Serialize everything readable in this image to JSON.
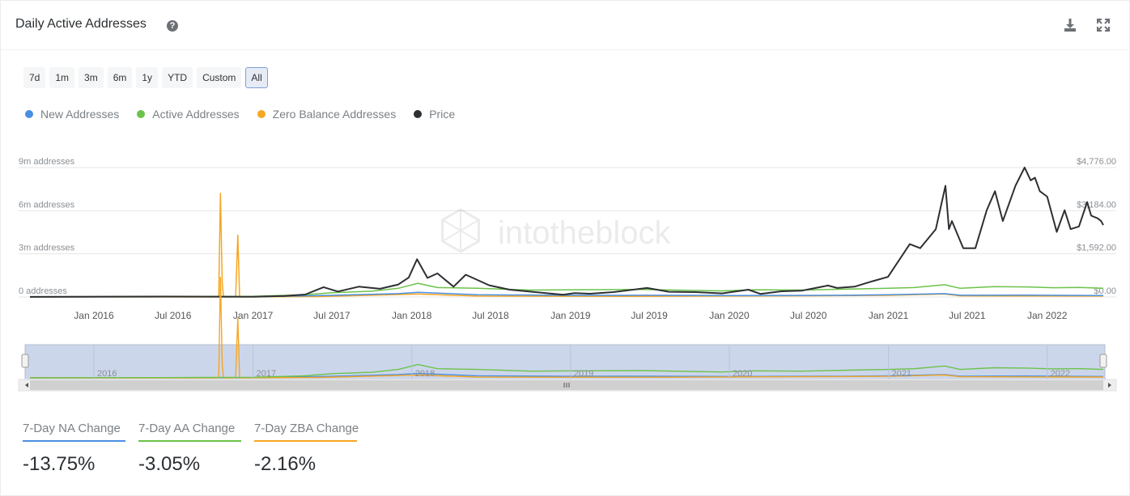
{
  "header": {
    "title": "Daily Active Addresses",
    "help_icon": "question-circle-icon",
    "download_icon": "download-icon",
    "expand_icon": "expand-icon"
  },
  "ranges": [
    "7d",
    "1m",
    "3m",
    "6m",
    "1y",
    "YTD",
    "Custom",
    "All"
  ],
  "active_range": "All",
  "legend": [
    {
      "name": "New Addresses",
      "color": "#4a90e2"
    },
    {
      "name": "Active Addresses",
      "color": "#6cc24a"
    },
    {
      "name": "Zero Balance Addresses",
      "color": "#f5a623"
    },
    {
      "name": "Price",
      "color": "#2d3033"
    }
  ],
  "watermark": "intotheblock",
  "chart_data": {
    "type": "line",
    "x_ticks": [
      "Jan 2016",
      "Jul 2016",
      "Jan 2017",
      "Jul 2017",
      "Jan 2018",
      "Jul 2018",
      "Jan 2019",
      "Jul 2019",
      "Jan 2020",
      "Jul 2020",
      "Jan 2021",
      "Jul 2021",
      "Jan 2022"
    ],
    "y_left_ticks": [
      "0 addresses",
      "3m addresses",
      "6m addresses",
      "9m addresses"
    ],
    "y_left_range": [
      0,
      9000000
    ],
    "y_right_ticks": [
      "$0.00",
      "$1,592.00",
      "$3,184.00",
      "$4,776.00"
    ],
    "y_right_range": [
      0,
      4776
    ],
    "x_range": [
      "2015-08-07",
      "2022-05-10"
    ],
    "navigator_labels": [
      "2016",
      "2017",
      "2018",
      "2019",
      "2020",
      "2021",
      "2022"
    ],
    "grid": true,
    "series": [
      {
        "name": "Price",
        "axis": "right",
        "color": "#2d3033",
        "points": [
          [
            "2015-08-07",
            2
          ],
          [
            "2016-06-15",
            14
          ],
          [
            "2017-01-01",
            8
          ],
          [
            "2017-03-15",
            40
          ],
          [
            "2017-05-01",
            90
          ],
          [
            "2017-06-12",
            360
          ],
          [
            "2017-07-15",
            200
          ],
          [
            "2017-09-01",
            380
          ],
          [
            "2017-10-20",
            300
          ],
          [
            "2017-12-01",
            460
          ],
          [
            "2017-12-25",
            720
          ],
          [
            "2018-01-13",
            1390
          ],
          [
            "2018-02-06",
            700
          ],
          [
            "2018-03-01",
            870
          ],
          [
            "2018-04-07",
            380
          ],
          [
            "2018-05-05",
            820
          ],
          [
            "2018-06-28",
            430
          ],
          [
            "2018-08-14",
            270
          ],
          [
            "2018-09-15",
            220
          ],
          [
            "2018-11-25",
            110
          ],
          [
            "2018-12-15",
            85
          ],
          [
            "2019-01-10",
            140
          ],
          [
            "2019-02-15",
            120
          ],
          [
            "2019-04-10",
            180
          ],
          [
            "2019-06-26",
            330
          ],
          [
            "2019-08-15",
            190
          ],
          [
            "2019-10-15",
            180
          ],
          [
            "2019-12-15",
            130
          ],
          [
            "2020-02-14",
            270
          ],
          [
            "2020-03-13",
            110
          ],
          [
            "2020-04-30",
            210
          ],
          [
            "2020-06-15",
            230
          ],
          [
            "2020-08-15",
            420
          ],
          [
            "2020-09-05",
            330
          ],
          [
            "2020-10-15",
            380
          ],
          [
            "2020-11-25",
            580
          ],
          [
            "2020-12-31",
            740
          ],
          [
            "2021-02-19",
            1950
          ],
          [
            "2021-03-15",
            1800
          ],
          [
            "2021-04-20",
            2500
          ],
          [
            "2021-05-12",
            4100
          ],
          [
            "2021-05-20",
            2500
          ],
          [
            "2021-05-27",
            2800
          ],
          [
            "2021-06-22",
            1800
          ],
          [
            "2021-07-20",
            1800
          ],
          [
            "2021-08-15",
            3200
          ],
          [
            "2021-09-03",
            3900
          ],
          [
            "2021-09-21",
            2800
          ],
          [
            "2021-10-20",
            4100
          ],
          [
            "2021-11-10",
            4776
          ],
          [
            "2021-11-24",
            4300
          ],
          [
            "2021-12-04",
            4400
          ],
          [
            "2021-12-15",
            3900
          ],
          [
            "2022-01-01",
            3700
          ],
          [
            "2022-01-23",
            2400
          ],
          [
            "2022-02-10",
            3200
          ],
          [
            "2022-02-24",
            2500
          ],
          [
            "2022-03-15",
            2600
          ],
          [
            "2022-04-03",
            3500
          ],
          [
            "2022-04-12",
            3000
          ],
          [
            "2022-04-27",
            2900
          ],
          [
            "2022-05-05",
            2800
          ],
          [
            "2022-05-10",
            2650
          ]
        ]
      },
      {
        "name": "Active Addresses",
        "axis": "left",
        "color": "#6cc24a",
        "points": [
          [
            "2015-08-07",
            8000
          ],
          [
            "2016-06-01",
            20000
          ],
          [
            "2017-01-01",
            40000
          ],
          [
            "2017-05-01",
            150000
          ],
          [
            "2017-07-01",
            300000
          ],
          [
            "2017-10-01",
            400000
          ],
          [
            "2017-12-01",
            600000
          ],
          [
            "2018-01-15",
            950000
          ],
          [
            "2018-03-01",
            650000
          ],
          [
            "2018-06-01",
            600000
          ],
          [
            "2018-10-01",
            480000
          ],
          [
            "2019-01-15",
            500000
          ],
          [
            "2019-06-15",
            520000
          ],
          [
            "2019-12-15",
            420000
          ],
          [
            "2020-03-01",
            500000
          ],
          [
            "2020-06-15",
            480000
          ],
          [
            "2020-10-01",
            550000
          ],
          [
            "2021-01-01",
            600000
          ],
          [
            "2021-03-01",
            650000
          ],
          [
            "2021-05-10",
            850000
          ],
          [
            "2021-06-15",
            600000
          ],
          [
            "2021-09-01",
            720000
          ],
          [
            "2021-11-15",
            700000
          ],
          [
            "2022-01-15",
            640000
          ],
          [
            "2022-03-15",
            660000
          ],
          [
            "2022-05-10",
            600000
          ]
        ]
      },
      {
        "name": "New Addresses",
        "axis": "left",
        "color": "#4a90e2",
        "points": [
          [
            "2015-08-07",
            3000
          ],
          [
            "2017-01-01",
            15000
          ],
          [
            "2017-07-01",
            110000
          ],
          [
            "2017-12-01",
            230000
          ],
          [
            "2018-01-15",
            320000
          ],
          [
            "2018-06-01",
            150000
          ],
          [
            "2019-01-15",
            110000
          ],
          [
            "2019-06-15",
            120000
          ],
          [
            "2020-01-01",
            100000
          ],
          [
            "2020-10-01",
            120000
          ],
          [
            "2021-01-01",
            150000
          ],
          [
            "2021-05-10",
            230000
          ],
          [
            "2021-06-15",
            120000
          ],
          [
            "2021-11-15",
            130000
          ],
          [
            "2022-05-10",
            100000
          ]
        ]
      },
      {
        "name": "Zero Balance Addresses",
        "axis": "left",
        "color": "#f5a623",
        "points": [
          [
            "2015-08-07",
            0
          ],
          [
            "2016-10-14",
            0
          ],
          [
            "2016-10-18",
            7200000
          ],
          [
            "2016-10-22",
            1000000
          ],
          [
            "2016-10-25",
            0
          ],
          [
            "2016-11-22",
            0
          ],
          [
            "2016-11-27",
            4300000
          ],
          [
            "2016-12-01",
            0
          ],
          [
            "2017-06-01",
            30000
          ],
          [
            "2018-01-15",
            200000
          ],
          [
            "2018-06-01",
            60000
          ],
          [
            "2019-06-01",
            40000
          ],
          [
            "2020-09-01",
            90000
          ],
          [
            "2021-01-01",
            110000
          ],
          [
            "2021-05-10",
            200000
          ],
          [
            "2021-06-15",
            80000
          ],
          [
            "2022-05-10",
            60000
          ]
        ]
      }
    ]
  },
  "stats": [
    {
      "label": "7-Day NA Change",
      "value": "-13.75%",
      "color": "#4a90e2"
    },
    {
      "label": "7-Day AA Change",
      "value": "-3.05%",
      "color": "#6cc24a"
    },
    {
      "label": "7-Day ZBA Change",
      "value": "-2.16%",
      "color": "#f5a623"
    }
  ]
}
